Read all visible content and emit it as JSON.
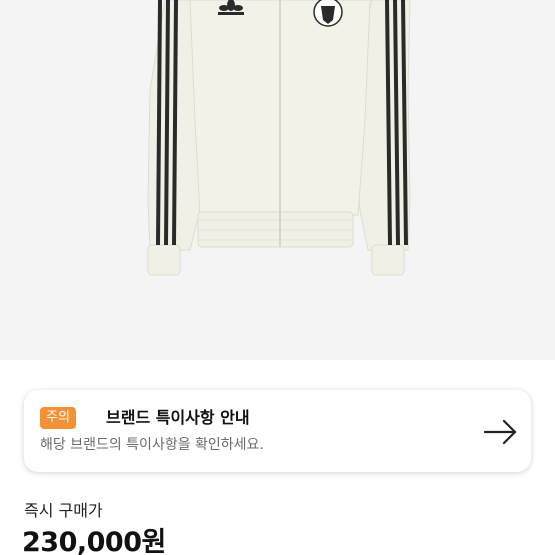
{
  "product": {
    "image_alt_icon": "track-jacket-image"
  },
  "notice": {
    "badge": "주의",
    "title": "브랜드 특이사항 안내",
    "description": "해당 브랜드의 특이사항을 확인하세요.",
    "arrow_icon": "arrow-right-icon",
    "badge_color": "#f39137"
  },
  "price": {
    "label": "즉시 구매가",
    "value": "230,000원"
  }
}
